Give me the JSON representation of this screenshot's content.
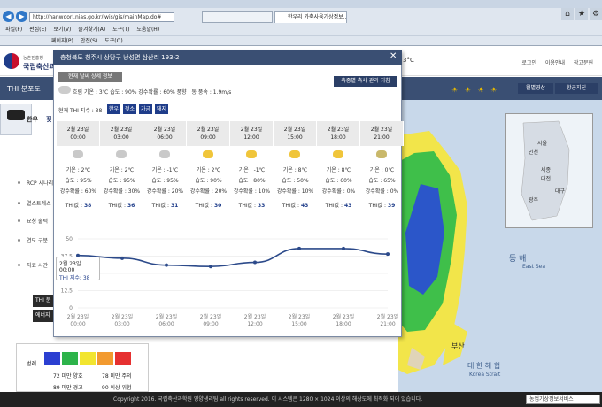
{
  "browser": {
    "url": "http://hanwoori.nias.go.kr/lwis/gis/mainMap.do#",
    "tabs": [
      {
        "label": ""
      },
      {
        "label": "한우리 가축사육기상정보..."
      }
    ],
    "menu": [
      "파일(F)",
      "편집(E)",
      "보기(V)",
      "즐겨찾기(A)",
      "도구(T)",
      "도움말(H)"
    ],
    "toolbar": [
      "페이지(P)",
      "안전(S)",
      "도구(O)"
    ]
  },
  "header": {
    "agency_sub": "농촌진흥청",
    "agency": "국립축산과학원",
    "links": [
      "로그인",
      "이용안내",
      "참고문헌"
    ],
    "temp_fragment": "3°C"
  },
  "left": {
    "section_title": "THI 분포도",
    "animal_tab": "한우",
    "animal_tab2": "젖",
    "items": [
      "RCP 시나리",
      "열스트레스",
      "요청 출력",
      "연도 구분",
      "자료 시간"
    ],
    "dark_buttons": [
      "THI 분",
      "에너지"
    ]
  },
  "map": {
    "sea_label": "동 해",
    "sea_label_en": "East Sea",
    "strait_label": "대 한 해 협",
    "strait_label_en": "Korea Strait",
    "city": "부산",
    "minimap_cities": [
      "서울",
      "인천",
      "세종",
      "대전",
      "광주",
      "대구"
    ],
    "video_button": "월별영상",
    "sat_button": "항공지진"
  },
  "legend": {
    "title": "범례",
    "colors": [
      "#2b3fd1",
      "#2db34a",
      "#f2e52f",
      "#f29a2f",
      "#e63030"
    ],
    "items": [
      "72 미만 양호",
      "78 미만 주의",
      "89 미만 경고",
      "90 이상 위험"
    ]
  },
  "popup": {
    "title": "충청북도 청주시 상당구 낭성면 삼산리 193-2",
    "detail_button": "현재 날씨 상세 정보",
    "mgmt_button": "축종별 축사 관리 지침",
    "current_weather": "흐림 기온 : 3℃ 습도 : 90% 강수확률 : 60% 풍향 : 동 풍속 : 1.9m/s",
    "thi_now_label": "현재 THI 지수 : 38",
    "badges": [
      {
        "label": "한우",
        "color": "#1f3d8a"
      },
      {
        "label": "젖소",
        "color": "#1f3d8a"
      },
      {
        "label": "가금",
        "color": "#1f3d8a"
      },
      {
        "label": "돼지",
        "color": "#1f3d8a"
      }
    ],
    "forecast": [
      {
        "date": "2월 23일",
        "time": "00:00",
        "temp": "기온 : 2℃",
        "humid": "습도 : 95%",
        "rain": "강수확률 : 60%",
        "thi_label": "THI값 : ",
        "thi": "38",
        "icon": "cloud"
      },
      {
        "date": "2월 23일",
        "time": "03:00",
        "temp": "기온 : 2℃",
        "humid": "습도 : 95%",
        "rain": "강수확률 : 30%",
        "thi_label": "THI값 : ",
        "thi": "36",
        "icon": "cloud"
      },
      {
        "date": "2월 23일",
        "time": "06:00",
        "temp": "기온 : -1℃",
        "humid": "습도 : 95%",
        "rain": "강수확률 : 20%",
        "thi_label": "THI값 : ",
        "thi": "31",
        "icon": "cloud"
      },
      {
        "date": "2월 23일",
        "time": "09:00",
        "temp": "기온 : 2℃",
        "humid": "습도 : 90%",
        "rain": "강수확률 : 20%",
        "thi_label": "THI값 : ",
        "thi": "30",
        "icon": "partly"
      },
      {
        "date": "2월 23일",
        "time": "12:00",
        "temp": "기온 : -1℃",
        "humid": "습도 : 80%",
        "rain": "강수확률 : 10%",
        "thi_label": "THI값 : ",
        "thi": "33",
        "icon": "partly"
      },
      {
        "date": "2월 23일",
        "time": "15:00",
        "temp": "기온 : 8℃",
        "humid": "습도 : 50%",
        "rain": "강수확률 : 10%",
        "thi_label": "THI값 : ",
        "thi": "43",
        "icon": "sun"
      },
      {
        "date": "2월 23일",
        "time": "18:00",
        "temp": "기온 : 8℃",
        "humid": "습도 : 60%",
        "rain": "강수확률 : 0%",
        "thi_label": "THI값 : ",
        "thi": "43",
        "icon": "sun"
      },
      {
        "date": "2월 23일",
        "time": "21:00",
        "temp": "기온 : 0℃",
        "humid": "습도 : 65%",
        "rain": "강수확률 : 0%",
        "thi_label": "THI값 : ",
        "thi": "39",
        "icon": "moon"
      }
    ],
    "tooltip": {
      "date": "2월 23일 00:00",
      "value": "THI 지수: 38"
    }
  },
  "chart_data": {
    "type": "line",
    "categories": [
      "2월 23일 00:00",
      "2월 23일 03:00",
      "2월 23일 06:00",
      "2월 23일 09:00",
      "2월 23일 12:00",
      "2월 23일 15:00",
      "2월 23일 18:00",
      "2월 23일 21:00"
    ],
    "tick_labels": [
      [
        "2월 23일",
        "00:00"
      ],
      [
        "2월 23일",
        "03:00"
      ],
      [
        "2월 23일",
        "06:00"
      ],
      [
        "2월 23일",
        "09:00"
      ],
      [
        "2월 23일",
        "12:00"
      ],
      [
        "2월 23일",
        "15:00"
      ],
      [
        "2월 23일",
        "18:00"
      ],
      [
        "2월 23일",
        "21:00"
      ]
    ],
    "series": [
      {
        "values": [
          38,
          36,
          31,
          30,
          33,
          43,
          43,
          39
        ],
        "color": "#2c4a8a"
      }
    ],
    "yticks": [
      "50",
      "37.5",
      "25",
      "12.5",
      "0"
    ],
    "ylim": [
      0,
      50
    ],
    "grid": true
  },
  "footer": {
    "text": "Copyright 2016. 국립축산과학원 영양생리팀 all rights reserved. 이 시스템은 1280 × 1024 이상의 해상도에 최적화 되어 있습니다.",
    "select": "농업기상정보서비스"
  }
}
